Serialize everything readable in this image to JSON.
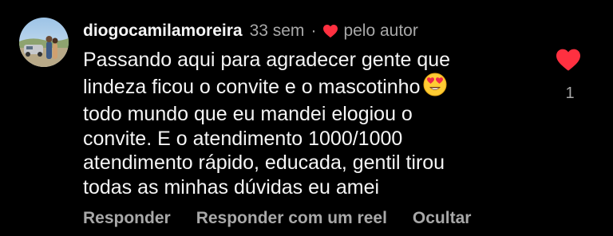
{
  "comment": {
    "username": "diogocamilamoreira",
    "time": "33 sem",
    "separator": "·",
    "author_like_label": "pelo autor",
    "lines": [
      "Passando aqui para agradecer gente que",
      "lindeza ficou o convite e o mascotinho",
      "todo mundo que eu mandei elogiou o",
      "convite. E o atendimento 1000/1000",
      "atendimento rápido, educada, gentil tirou",
      "todas as minhas dúvidas eu amei"
    ],
    "emoji": "heart-eyes-emoji",
    "like_count": "1",
    "actions": {
      "reply": "Responder",
      "reply_reel": "Responder com um reel",
      "hide": "Ocultar"
    }
  },
  "icons": {
    "avatar": "avatar-photo",
    "author_heart": "heart-icon",
    "like": "heart-filled-icon"
  },
  "colors": {
    "background": "#000000",
    "text": "#f5f5f5",
    "muted": "#a8a8a8",
    "heart": "#ff3040"
  }
}
